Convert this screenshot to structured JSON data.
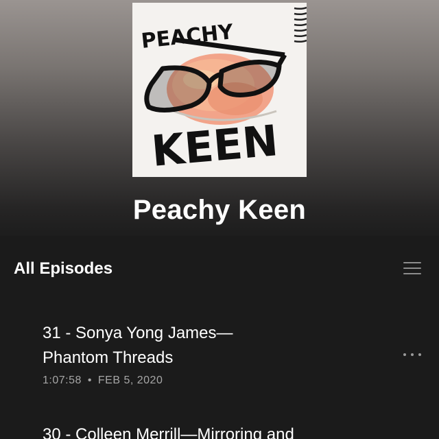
{
  "show": {
    "title": "Peachy Keen",
    "cover_text_top": "PEACHY",
    "cover_text_bottom": "KEEN"
  },
  "section": {
    "title": "All Episodes",
    "sort_icon": "hamburger-sort-icon"
  },
  "episodes": [
    {
      "title_line1": "31 - Sonya Yong James—",
      "title_line2": "Phantom Threads",
      "duration": "1:07:58",
      "separator": "•",
      "date": "FEB 5, 2020",
      "more_icon": "more-horizontal-icon"
    },
    {
      "title_line1": "30 - Colleen Merrill—Mirroring and"
    }
  ],
  "colors": {
    "background": "#1b1b1b",
    "hero_top": "#9a9491",
    "text_primary": "#ffffff",
    "text_secondary": "#a7a7a7"
  }
}
